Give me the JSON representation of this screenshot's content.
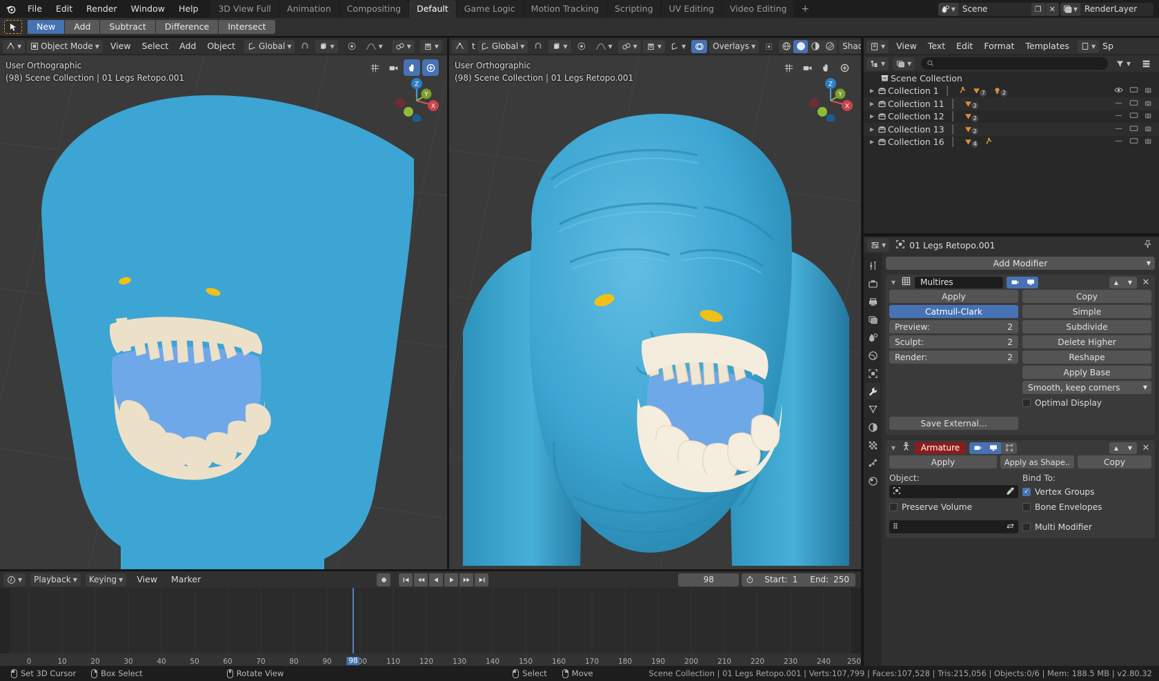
{
  "topbar": {
    "menus": [
      "File",
      "Edit",
      "Render",
      "Window",
      "Help"
    ],
    "workspaces": [
      {
        "label": "3D View Full",
        "active": false
      },
      {
        "label": "Animation",
        "active": false
      },
      {
        "label": "Compositing",
        "active": false
      },
      {
        "label": "Default",
        "active": true
      },
      {
        "label": "Game Logic",
        "active": false
      },
      {
        "label": "Motion Tracking",
        "active": false
      },
      {
        "label": "Scripting",
        "active": false
      },
      {
        "label": "UV Editing",
        "active": false
      },
      {
        "label": "Video Editing",
        "active": false
      }
    ],
    "add_workspace": "+",
    "scene_name": "Scene",
    "viewlayer_name": "RenderLayer",
    "scene_icon": "scene-icon",
    "viewlayer_icon": "render-layers-icon",
    "copy_icon": "duplicate-icon",
    "close_icon": "x-icon"
  },
  "booltool": {
    "cursor_icon": "select-tool-icon",
    "buttons": [
      {
        "label": "New",
        "active": true
      },
      {
        "label": "Add",
        "active": false
      },
      {
        "label": "Subtract",
        "active": false
      },
      {
        "label": "Difference",
        "active": false
      },
      {
        "label": "Intersect",
        "active": false
      }
    ]
  },
  "viewport_left": {
    "editor_icon": "editor-type-icon",
    "mode": "Object Mode",
    "menus": [
      "View",
      "Select",
      "Add",
      "Object"
    ],
    "orientation": "Global",
    "snap_icon": "magnet-icon",
    "snap_mode_icon": "snap-increment-icon",
    "proportional_icon": "proportional-edit-icon",
    "falloff_icon": "smooth-falloff-icon",
    "pivot_icon": "pivot-icon",
    "overlay_text_top": "User Orthographic",
    "overlay_text_sub": "(98) Scene Collection | 01 Legs Retopo.001",
    "gizmo_icons": [
      "grid-icon",
      "camera-icon",
      "hand-icon",
      "zoom-icon"
    ],
    "axis_labels": [
      "Z",
      "Y",
      "X"
    ]
  },
  "viewport_right": {
    "mode_icon": "editor-type-icon",
    "orientation": "Global",
    "overlays_label": "Overlays",
    "shading_label": "Shading",
    "overlay_text_top": "User Orthographic",
    "overlay_text_sub": "(98) Scene Collection | 01 Legs Retopo.001",
    "gizmo_icons": [
      "grid-icon",
      "camera-icon",
      "hand-icon",
      "zoom-icon"
    ],
    "axis_labels": [
      "Z",
      "Y",
      "X"
    ],
    "shading_modes": [
      "wireframe",
      "solid",
      "lookdev",
      "rendered"
    ],
    "shading_active_index": 1
  },
  "texteditor_header": {
    "editor_icon": "text-editor-icon",
    "menus": [
      "View",
      "Text",
      "Edit",
      "Format",
      "Templates"
    ],
    "trailing": "Sp"
  },
  "outliner": {
    "display_mode_icon": "outliner-icon",
    "filter_mode_icon": "blender-file-icon",
    "search_placeholder": "",
    "search_icon": "search-icon",
    "filter_icon": "filter-icon",
    "options_icon": "options-icon",
    "root": {
      "label": "Scene Collection",
      "icon": "scene-collection-icon"
    },
    "rows": [
      {
        "label": "Collection 1",
        "icon": "collection-icon",
        "badges": [
          "armature-icon",
          "mesh-icon:7",
          "light-icon:2"
        ]
      },
      {
        "label": "Collection 11",
        "icon": "collection-icon",
        "badges": [
          "mesh-icon:2"
        ]
      },
      {
        "label": "Collection 12",
        "icon": "collection-icon",
        "badges": [
          "mesh-icon:2"
        ]
      },
      {
        "label": "Collection 13",
        "icon": "collection-icon",
        "badges": [
          "mesh-icon:2"
        ]
      },
      {
        "label": "Collection 16",
        "icon": "collection-icon",
        "badges": [
          "mesh-icon:4",
          "armature-icon"
        ]
      }
    ],
    "row_controls": [
      "restrict-select-icon",
      "restrict-viewport-icon",
      "restrict-render-icon"
    ]
  },
  "properties": {
    "editor_icon": "properties-editor-icon",
    "object_icon": "object-data-icon",
    "object_name": "01 Legs Retopo.001",
    "pin_icon": "pin-icon",
    "tabs": [
      "tool-icon",
      "render-icon",
      "output-icon",
      "view-layer-icon",
      "scene-icon",
      "world-icon",
      "object-icon",
      "modifier-icon",
      "particles-icon",
      "physics-icon",
      "constraints-icon",
      "data-icon",
      "material-icon"
    ],
    "active_tab_index": 7,
    "add_modifier": "Add Modifier",
    "modifiers": [
      {
        "name": "Multires",
        "icon": "multires-icon",
        "header_toggles": [
          "render-toggle",
          "realtime-toggle"
        ],
        "apply": "Apply",
        "copy": "Copy",
        "subdivision_type": "Catmull-Clark",
        "simple": "Simple",
        "subdivide": "Subdivide",
        "delete_higher": "Delete Higher",
        "reshape": "Reshape",
        "apply_base": "Apply Base",
        "levels": [
          {
            "label": "Preview:",
            "value": "2"
          },
          {
            "label": "Sculpt:",
            "value": "2"
          },
          {
            "label": "Render:",
            "value": "2"
          }
        ],
        "uv_smooth": "Smooth, keep corners",
        "optimal_display": {
          "label": "Optimal Display",
          "checked": false
        },
        "save_external": "Save External..."
      },
      {
        "name": "Armature",
        "icon": "armature-icon",
        "header_toggles": [
          "render-toggle",
          "realtime-toggle",
          "edit-mode-toggle"
        ],
        "apply": "Apply",
        "apply_as_shape": "Apply as Shape..",
        "copy": "Copy",
        "object_label": "Object:",
        "object_value": "",
        "eyedropper_icon": "eyedropper-icon",
        "bind_to_label": "Bind To:",
        "vertex_groups": {
          "label": "Vertex Groups",
          "checked": true
        },
        "bone_envelopes": {
          "label": "Bone Envelopes",
          "checked": false
        },
        "preserve_volume": {
          "label": "Preserve Volume",
          "checked": false
        },
        "multi_modifier": {
          "label": "Multi Modifier",
          "checked": false
        },
        "vertex_group_icon": "vertex-group-icon",
        "invert_icon": "invert-icon"
      }
    ]
  },
  "timeline": {
    "editor_icon": "timeline-icon",
    "menus": [
      "Playback",
      "Keying",
      "View",
      "Marker"
    ],
    "playback_dropdown": true,
    "keying_dropdown": true,
    "record_icon": "record-icon",
    "transport_icons": [
      "jump-start-icon",
      "prev-keyframe-icon",
      "play-reverse-icon",
      "play-icon",
      "next-keyframe-icon",
      "jump-end-icon"
    ],
    "current_frame": "98",
    "auto_key_icon": "stopwatch-icon",
    "start_label": "Start:",
    "start_value": "1",
    "end_label": "End:",
    "end_value": "250",
    "ruler_ticks": [
      "0",
      "10",
      "20",
      "30",
      "40",
      "50",
      "60",
      "70",
      "80",
      "90",
      "100",
      "110",
      "120",
      "130",
      "140",
      "150",
      "160",
      "170",
      "180",
      "190",
      "200",
      "210",
      "220",
      "230",
      "240",
      "250"
    ],
    "playhead_frame": 98,
    "playhead_label": "98"
  },
  "statusbar": {
    "hints": [
      {
        "icon": "mouse-left-icon",
        "label": "Set 3D Cursor"
      },
      {
        "icon": "mouse-right-icon",
        "label": "Box Select"
      },
      {
        "icon": "mouse-middle-icon",
        "label": "Rotate View"
      },
      {
        "icon": "mouse-left-icon",
        "label": "Select"
      },
      {
        "icon": "mouse-right-icon",
        "label": "Move"
      }
    ],
    "info": "Scene Collection | 01 Legs Retopo.001 | Verts:107,799 | Faces:107,528 | Tris:215,056 | Objects:0/6 | Mem: 188.5 MB | v2.80.32"
  },
  "colors": {
    "accent_blue": "#4772b3",
    "header_gray": "#303030",
    "panel_gray": "#3a3a3a",
    "viewport_bg": "#3a3a3a",
    "creature_blue": "#3ca5d3",
    "mouth_blue": "#6fa8e8",
    "teeth_cream": "#eadfc8",
    "eye_yellow": "#f0c019",
    "armature_red": "#8c1d1d",
    "outliner_orange": "#e08c3c"
  }
}
